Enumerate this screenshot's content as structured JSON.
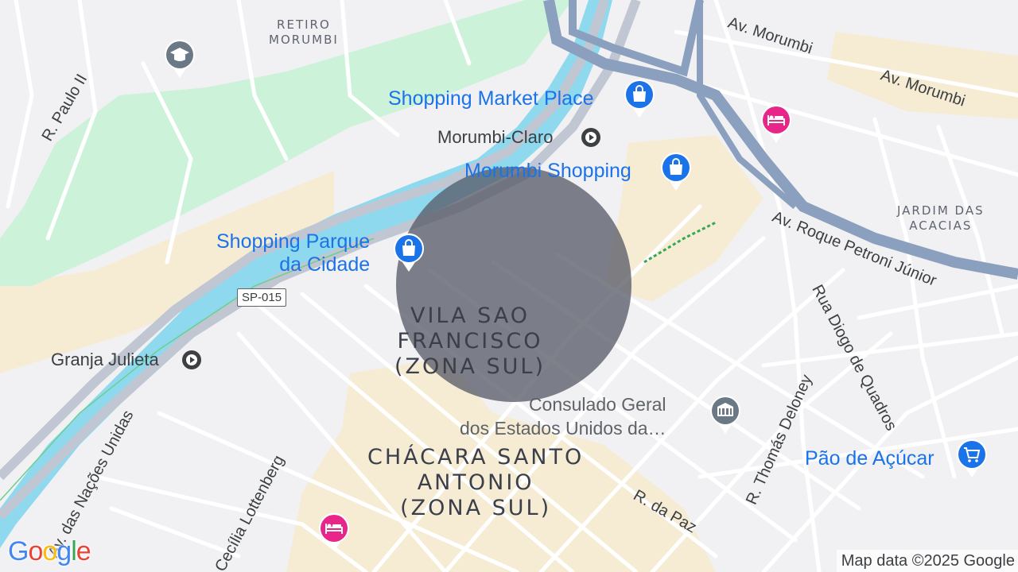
{
  "map": {
    "districts": {
      "retiro_morumbi": "RETIRO\nMORUMBI",
      "vila_sao_francisco": "VILA SAO\nFRANCISCO\n(ZONA SUL)",
      "chacara_santo_antonio": "CHÁCARA SANTO\nANTONIO\n(ZONA SUL)",
      "jardim_das_acacias": "JARDIM DAS\nACACIAS"
    },
    "streets": {
      "av_morumbi_1": "Av. Morumbi",
      "av_morumbi_2": "Av. Morumbi",
      "r_paulo_ii": "R. Paulo II",
      "av_roque_petroni": "Av. Roque Petroni Júnior",
      "rua_diogo_de_quadros": "Rua Diogo de Quadros",
      "r_thomas_deloney": "R. Thomás Deloney",
      "r_da_paz": "R. da Paz",
      "av_nacoes_unidas": "Av. das Nações Unidas",
      "cecilia_lottenberg": "Cecília Lottenberg"
    },
    "road_shield": "SP-015",
    "pois": {
      "shopping_market_place": "Shopping Market Place",
      "morumbi_claro": "Morumbi-Claro",
      "morumbi_shopping": "Morumbi Shopping",
      "shopping_parque_da_cidade": "Shopping Parque\nda Cidade",
      "granja_julieta": "Granja Julieta",
      "consulado": "Consulado Geral\ndos Estados Unidos da…",
      "pao_de_acucar": "Pão de Açúcar"
    },
    "icons": {
      "school": "school-icon",
      "shopping": "shopping-bag-icon",
      "hotel": "hotel-icon",
      "transit": "transit-station-icon",
      "embassy": "embassy-icon",
      "grocery": "shopping-cart-icon"
    },
    "colors": {
      "water": "#8fd9ef",
      "park": "#ccf2d9",
      "highway": "#8aa0be",
      "commercial": "#f6ecd4",
      "poi_blue": "#1a73e8",
      "hotel_pink": "#e8268a",
      "circle_fill": "#5a5c69"
    },
    "attribution": "Map data ©2025 Google",
    "logo": "Google"
  }
}
